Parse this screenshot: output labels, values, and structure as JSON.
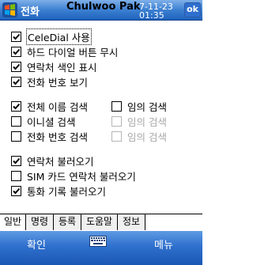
{
  "titlebar": {
    "title": "전화",
    "user": "Chulwoo Pak",
    "date": "7-11-23",
    "time": "01:35",
    "ok_label": "ok"
  },
  "options": {
    "celedial": "CeleDial 사용",
    "hard_dial": "하드 다이얼 버튼 무시",
    "contact_index": "연락처 색인 표시",
    "phone_number": "전화 번호 보기",
    "full_name_search": "전체 이름 검색",
    "any_search_1": "임의 검색",
    "initial_search": "이니셜 검색",
    "any_search_2": "임의 검색",
    "phone_number_search": "전화 번호 검색",
    "any_search_3": "임의 검색",
    "load_contacts": "연락처 불러오기",
    "load_sim_contacts": "SIM 카드 연락처 불러오기",
    "load_call_log": "통화 기록 불러오기"
  },
  "checked": {
    "celedial": true,
    "hard_dial": true,
    "contact_index": true,
    "phone_number": true,
    "full_name_search": true,
    "any_search_1": false,
    "initial_search": false,
    "any_search_2": false,
    "phone_number_search": false,
    "any_search_3": false,
    "load_contacts": true,
    "load_sim_contacts": false,
    "load_call_log": true
  },
  "tabs": [
    "일반",
    "명령",
    "등록",
    "도움말",
    "정보"
  ],
  "softkeys": {
    "left": "확인",
    "right": "메뉴"
  },
  "icons": {
    "logo": "windows-flag-icon",
    "keyboard": "keyboard-icon"
  },
  "colors": {
    "titlebar": "#2f6fcd",
    "softbar": "#2f6fcd"
  }
}
